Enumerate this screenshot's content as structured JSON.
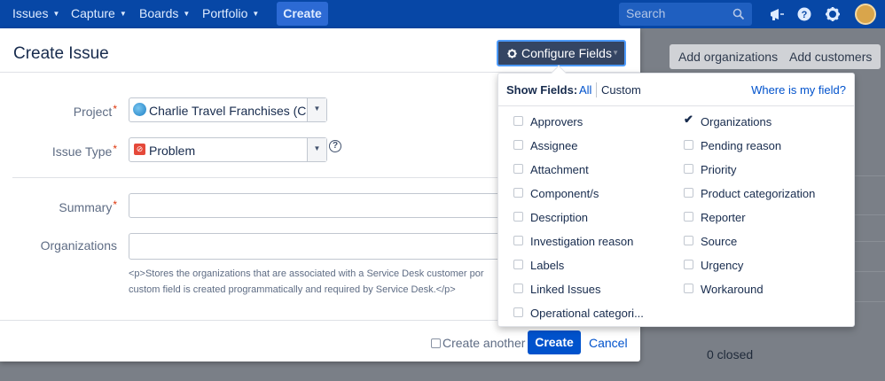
{
  "topnav": {
    "items": [
      {
        "label": "Issues"
      },
      {
        "label": "Capture"
      },
      {
        "label": "Boards"
      },
      {
        "label": "Portfolio"
      }
    ],
    "create_label": "Create",
    "search_placeholder": "Search"
  },
  "background": {
    "add_organizations": "Add organizations",
    "add_customers": "Add customers",
    "closed_text": "0 closed"
  },
  "dialog": {
    "title": "Create Issue",
    "configure_fields_label": "Configure Fields",
    "project": {
      "label": "Project",
      "value": "Charlie Travel Franchises (C..."
    },
    "issue_type": {
      "label": "Issue Type",
      "value": "Problem"
    },
    "summary": {
      "label": "Summary",
      "value": ""
    },
    "organizations": {
      "label": "Organizations",
      "value": "",
      "description_line1": "<p>Stores the organizations that are associated with a Service Desk customer por",
      "description_line2": "custom field is created programmatically and required by Service Desk.</p>"
    },
    "create_another_label": "Create another",
    "create_button": "Create",
    "cancel_link": "Cancel"
  },
  "fields_popup": {
    "show_fields_label": "Show Fields:",
    "all_label": "All",
    "custom_label": "Custom",
    "where_label": "Where is my field?",
    "column_left": [
      {
        "label": "Approvers",
        "checked": false
      },
      {
        "label": "Assignee",
        "checked": false
      },
      {
        "label": "Attachment",
        "checked": false
      },
      {
        "label": "Component/s",
        "checked": false
      },
      {
        "label": "Description",
        "checked": false
      },
      {
        "label": "Investigation reason",
        "checked": false
      },
      {
        "label": "Labels",
        "checked": false
      },
      {
        "label": "Linked Issues",
        "checked": false
      },
      {
        "label": "Operational categori...",
        "checked": false
      }
    ],
    "column_right": [
      {
        "label": "Organizations",
        "checked": true
      },
      {
        "label": "Pending reason",
        "checked": false
      },
      {
        "label": "Priority",
        "checked": false
      },
      {
        "label": "Product categorization",
        "checked": false
      },
      {
        "label": "Reporter",
        "checked": false
      },
      {
        "label": "Source",
        "checked": false
      },
      {
        "label": "Urgency",
        "checked": false
      },
      {
        "label": "Workaround",
        "checked": false
      }
    ]
  },
  "colors": {
    "nav_bg": "#0747a6",
    "primary": "#0052cc",
    "configure_bg": "#344563",
    "required": "#de350b"
  }
}
